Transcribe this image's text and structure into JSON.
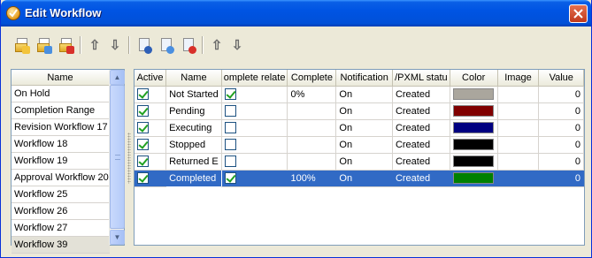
{
  "window": {
    "title": "Edit Workflow",
    "title_icon": "workflow-icon",
    "close_icon": "close-icon"
  },
  "toolbar": {
    "buttons": [
      {
        "name": "new-workflow-button",
        "icon": "new-document-icon"
      },
      {
        "name": "edit-workflow-button",
        "icon": "edit-document-icon"
      },
      {
        "name": "delete-workflow-button",
        "icon": "delete-document-icon"
      },
      {
        "name": "move-workflow-up-button",
        "icon": "arrow-up-icon"
      },
      {
        "name": "move-workflow-down-button",
        "icon": "arrow-down-icon"
      },
      {
        "name": "new-status-button",
        "icon": "new-status-icon"
      },
      {
        "name": "edit-status-button",
        "icon": "edit-status-icon"
      },
      {
        "name": "delete-status-button",
        "icon": "delete-status-icon"
      },
      {
        "name": "move-status-up-button",
        "icon": "arrow-up-icon"
      },
      {
        "name": "move-status-down-button",
        "icon": "arrow-down-icon"
      }
    ],
    "arrow_up": "⇧",
    "arrow_down": "⇩"
  },
  "workflow_list": {
    "header": "Name",
    "items": [
      "On Hold",
      "Completion Range",
      "Revision Workflow 17",
      "Workflow 18",
      "Workflow 19",
      "Approval Workflow 20",
      "Workflow 25",
      "Workflow 26",
      "Workflow 27",
      "Workflow 39"
    ],
    "selected_index": 9
  },
  "status_grid": {
    "columns": [
      "Active",
      "Name",
      "omplete relate",
      "Complete",
      "Notification",
      "/PXML statu",
      "Color",
      "Image",
      "Value"
    ],
    "rows": [
      {
        "active": true,
        "name": "Not Started",
        "complete_related": true,
        "complete": "0%",
        "notification": "On",
        "pxml_status": "Created",
        "color": "#aaa69d",
        "image": "",
        "value": "0"
      },
      {
        "active": true,
        "name": "Pending",
        "complete_related": false,
        "complete": "",
        "notification": "On",
        "pxml_status": "Created",
        "color": "#800000",
        "image": "",
        "value": "0"
      },
      {
        "active": true,
        "name": "Executing",
        "complete_related": false,
        "complete": "",
        "notification": "On",
        "pxml_status": "Created",
        "color": "#000080",
        "image": "",
        "value": "0"
      },
      {
        "active": true,
        "name": "Stopped",
        "complete_related": false,
        "complete": "",
        "notification": "On",
        "pxml_status": "Created",
        "color": "#000000",
        "image": "",
        "value": "0"
      },
      {
        "active": true,
        "name": "Returned E",
        "complete_related": false,
        "complete": "",
        "notification": "On",
        "pxml_status": "Created",
        "color": "#000000",
        "image": "",
        "value": "0"
      },
      {
        "active": true,
        "name": "Completed",
        "complete_related": true,
        "complete": "100%",
        "notification": "On",
        "pxml_status": "Created",
        "color": "#008000",
        "image": "",
        "value": "0"
      }
    ],
    "selected_index": 5
  }
}
